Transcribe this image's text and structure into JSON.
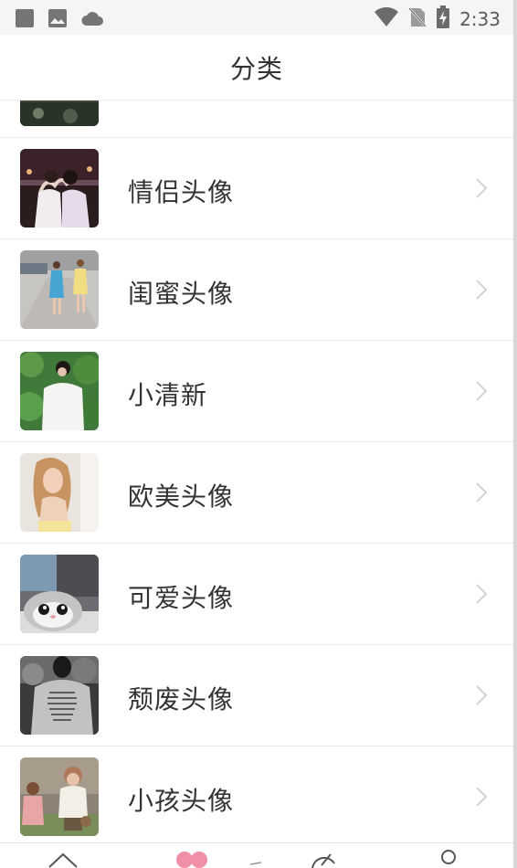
{
  "status_bar": {
    "time": "2:33",
    "left_icons": [
      "stop-square-icon",
      "image-icon",
      "cloud-icon"
    ],
    "right_icons": [
      "wifi-icon",
      "no-sim-icon",
      "battery-charging-icon"
    ]
  },
  "header": {
    "title": "分类"
  },
  "categories": [
    {
      "label": "",
      "thumb": "partial-photo"
    },
    {
      "label": "情侣头像",
      "thumb": "couple-photo"
    },
    {
      "label": "闺蜜头像",
      "thumb": "bestfriends-photo"
    },
    {
      "label": "小清新",
      "thumb": "fresh-photo"
    },
    {
      "label": "欧美头像",
      "thumb": "western-photo"
    },
    {
      "label": "可爱头像",
      "thumb": "cute-cat-photo"
    },
    {
      "label": "颓废头像",
      "thumb": "decadent-photo"
    },
    {
      "label": "小孩头像",
      "thumb": "kids-photo"
    }
  ],
  "bottom_nav": {
    "items": [
      "home-icon",
      "heart-icon",
      "create-icon",
      "profile-icon"
    ],
    "accent_color": "#f08fa8"
  },
  "colors": {
    "text": "#333333",
    "divider": "#e8e8e8",
    "chevron": "#cfcfcf",
    "status_bar_bg": "#f5f5f5"
  }
}
